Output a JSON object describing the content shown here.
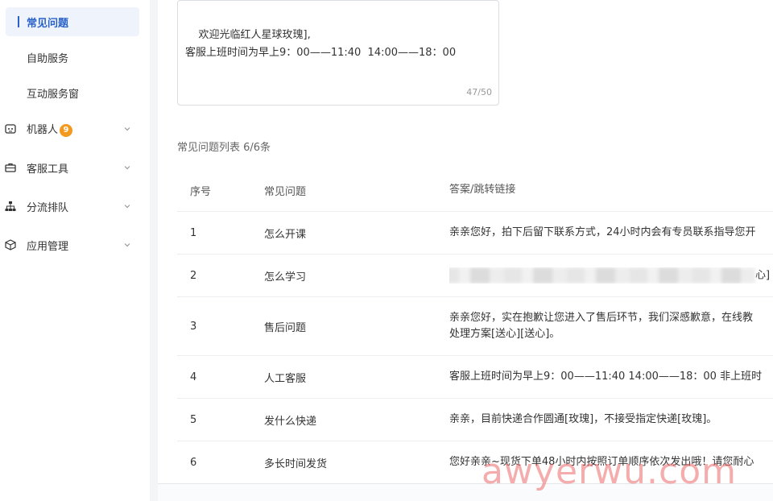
{
  "sidebar": {
    "sub_items": [
      {
        "label": "常见问题",
        "active": true
      },
      {
        "label": "自助服务",
        "active": false
      },
      {
        "label": "互动服务窗",
        "active": false
      }
    ],
    "groups": [
      {
        "label": "机器人",
        "icon": "robot-icon",
        "badge": "9"
      },
      {
        "label": "客服工具",
        "icon": "toolbox-icon"
      },
      {
        "label": "分流排队",
        "icon": "sitemap-icon"
      },
      {
        "label": "应用管理",
        "icon": "cube-icon"
      }
    ],
    "accent_color": "#2b62c9",
    "badge_color": "#f39a1e"
  },
  "welcome": {
    "text": "欢迎光临红人星球玫瑰],\n客服上班时间为早上9：00——11:40  14:00——18：00",
    "counter": "47/50"
  },
  "list_title": "常见问题列表 6/6条",
  "table": {
    "headers": [
      "序号",
      "常见问题",
      "答案/跳转链接"
    ],
    "rows": [
      {
        "no": "1",
        "question": "怎么开课",
        "answer": "亲亲您好，拍下后留下联系方式，24小时内会有专员联系指导您开"
      },
      {
        "no": "2",
        "question": "怎么学习",
        "answer": "心]"
      },
      {
        "no": "3",
        "question": "售后问题",
        "answer": "亲亲您好，实在抱歉让您进入了售后环节，我们深感歉意，在线教",
        "answer_line2": "处理方案[送心][送心]。"
      },
      {
        "no": "4",
        "question": "人工客服",
        "answer": "客服上班时间为早上9：00——11:40  14:00——18：00 非上班时"
      },
      {
        "no": "5",
        "question": "发什么快递",
        "answer": "亲亲，目前快递合作圆通[玫瑰]，不接受指定快递[玫瑰]。"
      },
      {
        "no": "6",
        "question": "多长时间发货",
        "answer": "您好亲亲~现货下单48小时内按照订单顺序依次发出哦！请您耐心"
      }
    ]
  },
  "watermark": "awyerwu.com"
}
